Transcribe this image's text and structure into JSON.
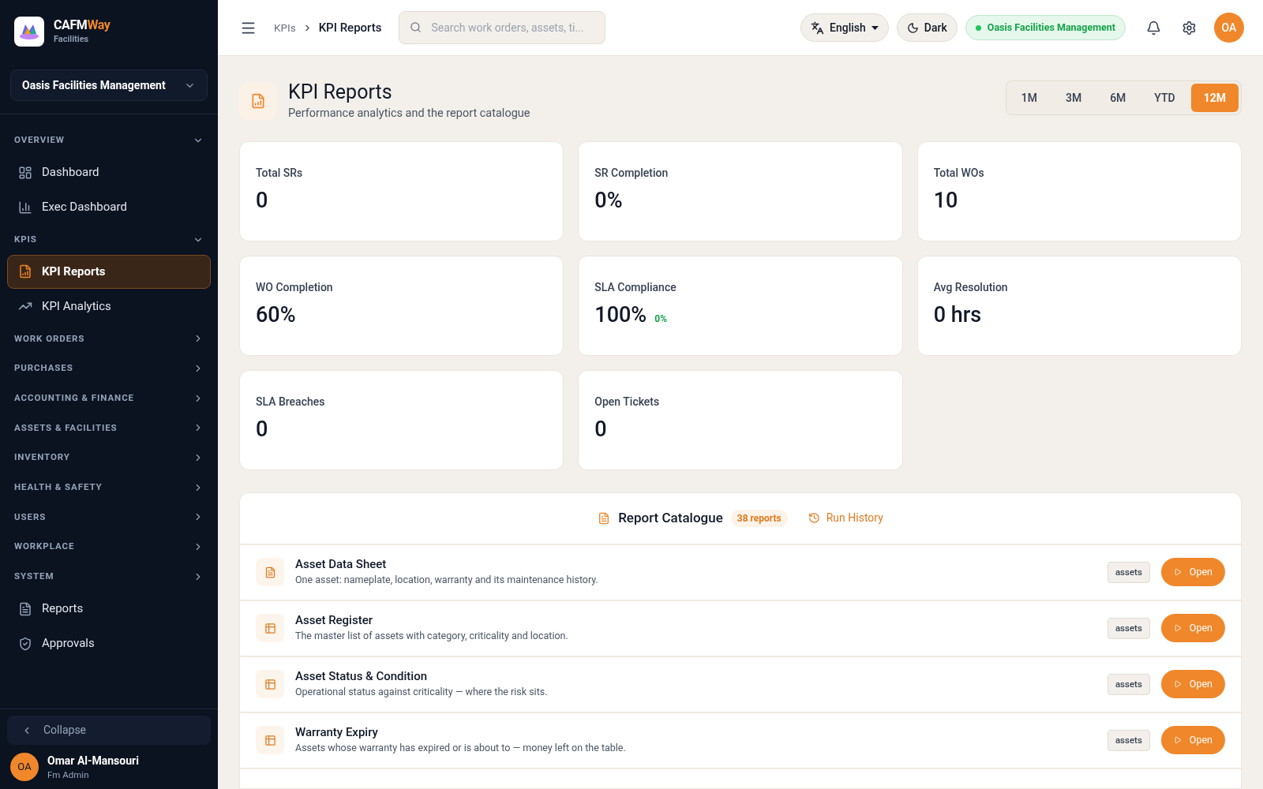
{
  "brand": {
    "name_part1": "CAFM",
    "name_part2": "Way",
    "subtitle": "Facilities"
  },
  "org_selector": {
    "value": "Oasis Facilities Management"
  },
  "sidebar": {
    "sections": [
      {
        "title": "OVERVIEW",
        "expanded": true,
        "items": [
          {
            "label": "Dashboard",
            "kind": "dashboard",
            "selected": false
          },
          {
            "label": "Exec Dashboard",
            "kind": "bars",
            "selected": false
          }
        ]
      },
      {
        "title": "KPIS",
        "expanded": true,
        "items": [
          {
            "label": "KPI Reports",
            "kind": "report",
            "selected": true
          },
          {
            "label": "KPI Analytics",
            "kind": "trend",
            "selected": false
          }
        ]
      },
      {
        "title": "WORK ORDERS",
        "expanded": false
      },
      {
        "title": "PURCHASES",
        "expanded": false
      },
      {
        "title": "ACCOUNTING & FINANCE",
        "expanded": false
      },
      {
        "title": "ASSETS & FACILITIES",
        "expanded": false
      },
      {
        "title": "INVENTORY",
        "expanded": false
      },
      {
        "title": "HEALTH & SAFETY",
        "expanded": false
      },
      {
        "title": "USERS",
        "expanded": false
      },
      {
        "title": "WORKPLACE",
        "expanded": false
      },
      {
        "title": "SYSTEM",
        "expanded": false,
        "items": [
          {
            "label": "Reports",
            "kind": "file",
            "selected": false
          },
          {
            "label": "Approvals",
            "kind": "shield",
            "selected": false
          }
        ]
      }
    ],
    "collapse_label": "Collapse"
  },
  "user": {
    "initials": "OA",
    "name": "Omar Al-Mansouri",
    "role": "Fm Admin"
  },
  "topbar": {
    "breadcrumb": [
      "KPIs",
      "KPI Reports"
    ],
    "search": {
      "placeholder": "Search work orders, assets, ti..."
    },
    "language": "English",
    "theme": "Dark",
    "org_badge": "Oasis Facilities Management",
    "avatar_initials": "OA"
  },
  "page": {
    "title": "KPI Reports",
    "subtitle": "Performance analytics and the report catalogue",
    "periods": [
      {
        "label": "1M",
        "selected": false
      },
      {
        "label": "3M",
        "selected": false
      },
      {
        "label": "6M",
        "selected": false
      },
      {
        "label": "YTD",
        "selected": false
      },
      {
        "label": "12M",
        "selected": true
      }
    ]
  },
  "kpis": [
    {
      "label": "Total SRs",
      "value": "0"
    },
    {
      "label": "SR Completion",
      "value": "0%"
    },
    {
      "label": "Total WOs",
      "value": "10"
    },
    {
      "label": "WO Completion",
      "value": "60%"
    },
    {
      "label": "SLA Compliance",
      "value": "100%",
      "delta": "0%"
    },
    {
      "label": "Avg Resolution",
      "value": "0 hrs"
    },
    {
      "label": "SLA Breaches",
      "value": "0"
    },
    {
      "label": "Open Tickets",
      "value": "0"
    }
  ],
  "catalogue": {
    "title": "Report Catalogue",
    "count": "38 reports",
    "run_history": "Run History",
    "reports": [
      {
        "title": "Asset Data Sheet",
        "description": "One asset: nameplate, location, warranty and its maintenance history.",
        "kind": "file",
        "tag": "assets",
        "action": "Open"
      },
      {
        "title": "Asset Register",
        "description": "The master list of assets with category, criticality and location.",
        "kind": "table",
        "tag": "assets",
        "action": "Open"
      },
      {
        "title": "Asset Status & Condition",
        "description": "Operational status against criticality — where the risk sits.",
        "kind": "table",
        "tag": "assets",
        "action": "Open"
      },
      {
        "title": "Warranty Expiry",
        "description": "Assets whose warranty has expired or is about to — money left on the table.",
        "kind": "table",
        "tag": "assets",
        "action": "Open"
      }
    ]
  }
}
